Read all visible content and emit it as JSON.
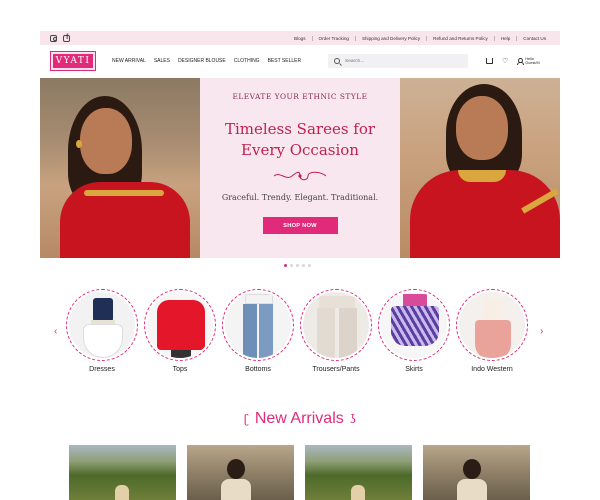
{
  "topbar": {
    "social": [
      "instagram-icon",
      "facebook-icon"
    ],
    "links": [
      "Blogs",
      "Order Tracking",
      "Shipping and Delivery Policy",
      "Refund and Returns Policy",
      "Help",
      "Contact Us"
    ]
  },
  "header": {
    "logo": "VYATI",
    "nav": [
      "NEW ARRIVAL",
      "SALES",
      "DESIGNER BLOUSE",
      "CLOTHING",
      "BEST SELLER"
    ],
    "search_placeholder": "Search...",
    "icons": [
      "cart-icon",
      "heart-icon",
      "user-icon"
    ],
    "user_greeting": "Hello",
    "user_name": "Guest/M"
  },
  "hero": {
    "eyebrow": "ELEVATE YOUR ETHNIC STYLE",
    "title": "Timeless Sarees for Every Occasion",
    "subtitle": "Graceful. Trendy. Elegant. Traditional.",
    "button": "SHOP NOW",
    "slides_count": 5,
    "active_slide": 1
  },
  "categories": {
    "prev_arrow": "‹",
    "next_arrow": "›",
    "items": [
      {
        "label": "Dresses"
      },
      {
        "label": "Tops"
      },
      {
        "label": "Bottoms"
      },
      {
        "label": "Trousers/Pants"
      },
      {
        "label": "Skirts"
      },
      {
        "label": "Indo Western"
      }
    ]
  },
  "new_arrivals": {
    "title": "New Arrivals",
    "ornament_left": "ʗ",
    "ornament_right": "ʖ"
  },
  "colors": {
    "brand": "#e12a79",
    "topbar_bg": "#f8e6ec",
    "hero_panel_bg": "#f8e7ee"
  }
}
